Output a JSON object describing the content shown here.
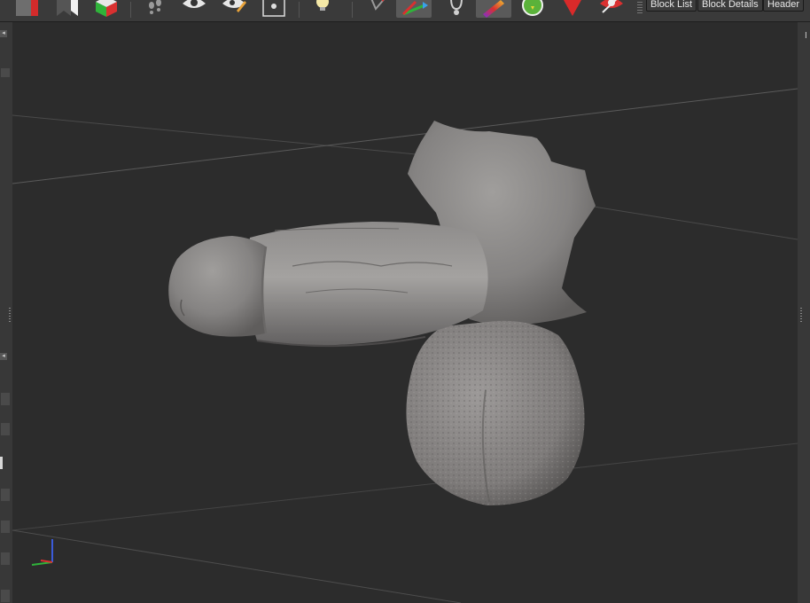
{
  "toolbar": {
    "tools": [
      {
        "name": "solid-cube-icon"
      },
      {
        "name": "bookmark-flag-icon"
      },
      {
        "name": "rgb-cube-icon"
      },
      {
        "name": "footprints-icon"
      },
      {
        "name": "eye-icon"
      },
      {
        "name": "eye-pencil-icon"
      },
      {
        "name": "camera-frame-icon"
      },
      {
        "name": "light-bulb-icon"
      },
      {
        "name": "pin-arrow-icon"
      },
      {
        "name": "transform-axes-icon"
      },
      {
        "name": "stethoscope-icon"
      },
      {
        "name": "gradient-brush-icon"
      },
      {
        "name": "green-circle-icon"
      },
      {
        "name": "red-location-pin-icon"
      },
      {
        "name": "hide-eye-icon"
      }
    ],
    "panel_buttons": [
      "Block List",
      "Block Details",
      "Header"
    ]
  },
  "right_panel": {
    "label": "I"
  },
  "viewport": {
    "background": "#2c2c2c",
    "model_color": "#8c8a89"
  }
}
